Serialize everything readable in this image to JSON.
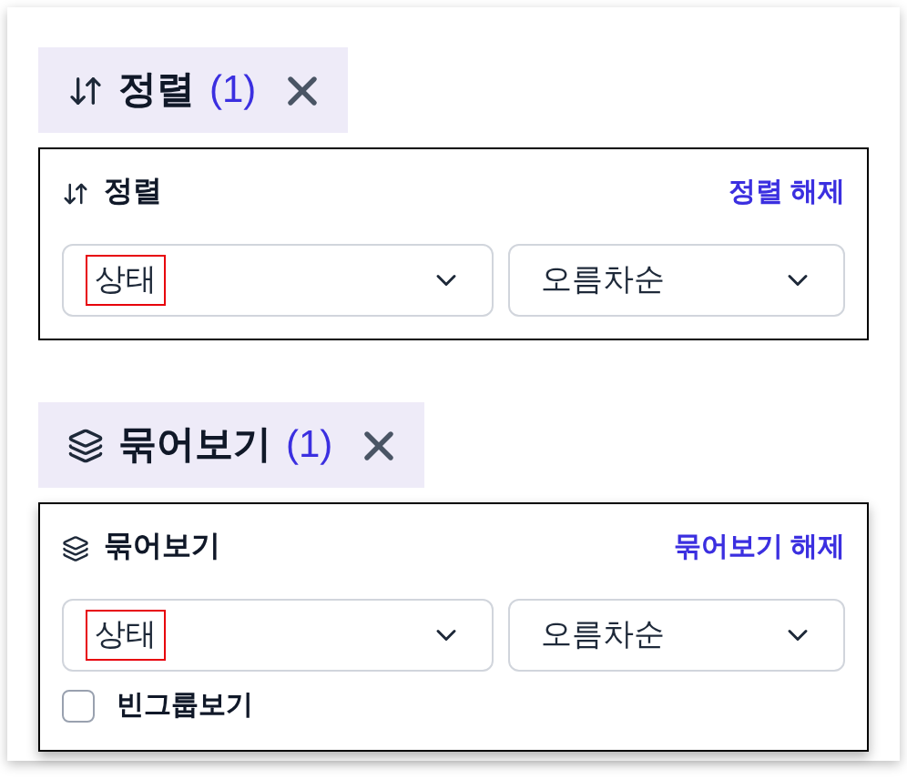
{
  "sections": [
    {
      "kind": "sort",
      "chip": {
        "label": "정렬",
        "count": "(1)"
      },
      "panel": {
        "title": "정렬",
        "clear_link": "정렬 해제",
        "field_select": {
          "value": "상태",
          "highlighted": true
        },
        "order_select": {
          "value": "오름차순"
        }
      }
    },
    {
      "kind": "group",
      "chip": {
        "label": "묶어보기",
        "count": "(1)"
      },
      "panel": {
        "title": "묶어보기",
        "clear_link": "묶어보기 해제",
        "field_select": {
          "value": "상태",
          "highlighted": true
        },
        "order_select": {
          "value": "오름차순"
        },
        "empty_groups": {
          "label": "빈그룹보기",
          "checked": false
        }
      }
    }
  ]
}
